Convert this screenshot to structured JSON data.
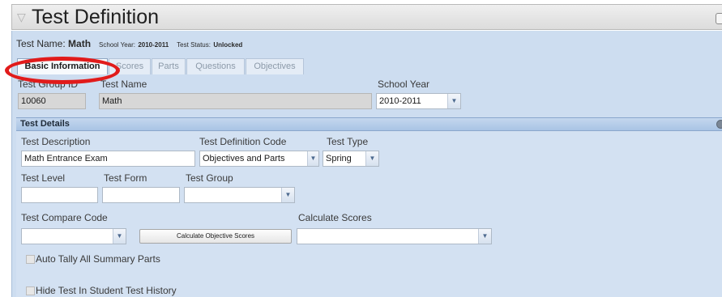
{
  "window": {
    "title": "Test Definition"
  },
  "info": {
    "test_name_label": "Test Name:",
    "test_name_value": "Math",
    "school_year_label": "School Year:",
    "school_year_value": "2010-2011",
    "test_status_label": "Test Status:",
    "test_status_value": "Unlocked"
  },
  "tabs": [
    {
      "label": "Basic Information",
      "active": true
    },
    {
      "label": "Scores",
      "active": false
    },
    {
      "label": "Parts",
      "active": false
    },
    {
      "label": "Questions",
      "active": false
    },
    {
      "label": "Objectives",
      "active": false
    }
  ],
  "header_fields": {
    "test_group_id_label": "Test Group ID",
    "test_group_id_value": "10060",
    "test_name_label": "Test Name",
    "test_name_value": "Math",
    "school_year_label": "School Year",
    "school_year_value": "2010-2011"
  },
  "details": {
    "section_title": "Test Details",
    "test_description_label": "Test Description",
    "test_description_value": "Math Entrance Exam",
    "test_definition_code_label": "Test Definition Code",
    "test_definition_code_value": "Objectives and Parts",
    "test_type_label": "Test Type",
    "test_type_value": "Spring",
    "test_level_label": "Test Level",
    "test_level_value": "",
    "test_form_label": "Test Form",
    "test_form_value": "",
    "test_group_label": "Test Group",
    "test_group_value": "",
    "test_compare_code_label": "Test Compare Code",
    "test_compare_code_value": "",
    "calculate_objective_scores_button": "Calculate Objective Scores",
    "calculate_scores_label": "Calculate Scores",
    "calculate_scores_value": "",
    "auto_tally_label": "Auto Tally All Summary Parts",
    "auto_tally_checked": false,
    "hide_test_label": "Hide Test In Student Test History",
    "hide_test_checked": false
  },
  "icons": {
    "dropdown": "chevron-down-icon",
    "collapse_title": "triangle-icon",
    "collapse_section": "collapse-icon"
  },
  "colors": {
    "panel_bg": "#cdddf0",
    "section_header": "#a9c4e4",
    "annotation_red": "#e11b1b"
  }
}
